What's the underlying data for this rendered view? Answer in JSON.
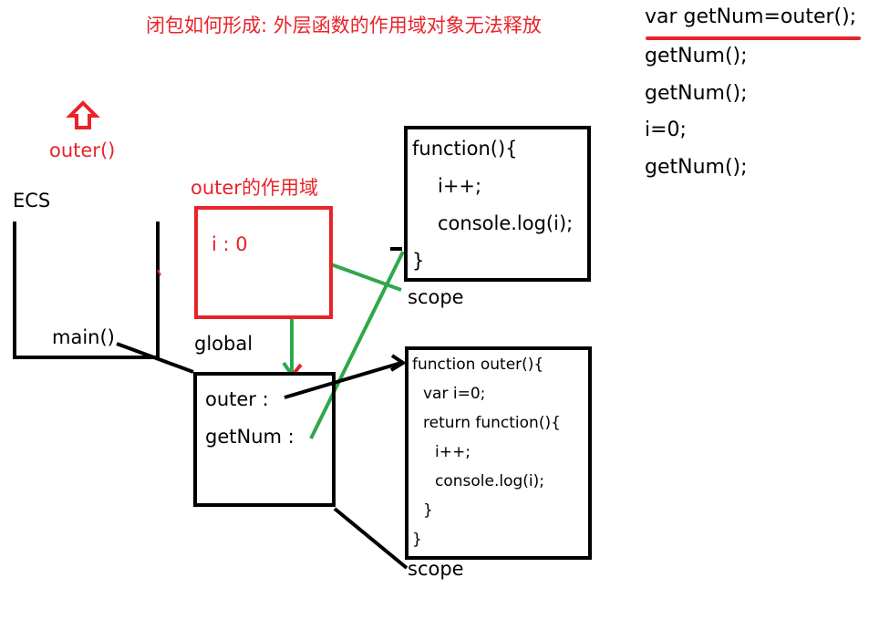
{
  "title": "闭包如何形成: 外层函数的作用域对象无法释放",
  "code_lines": [
    "var getNum=outer();",
    "getNum();",
    "getNum();",
    "i=0;",
    "getNum();"
  ],
  "stack": {
    "call_label": "outer()",
    "ecs_label": "ECS",
    "main_label": "main()"
  },
  "outer_scope": {
    "label": "outer的作用域",
    "var_i": "i : 0"
  },
  "global": {
    "label": "global",
    "outer_field": "outer :",
    "getnum_field": "getNum :"
  },
  "inner_function": {
    "lines": [
      "function(){",
      "i++;",
      "console.log(i);",
      "}"
    ],
    "scope_label": "scope"
  },
  "outer_function": {
    "lines": [
      "function outer(){",
      "var i=0;",
      "return function(){",
      "i++;",
      "console.log(i);",
      "}",
      "}"
    ],
    "scope_label": "scope"
  },
  "colors": {
    "red": "#e8232a",
    "green": "#2ea84a",
    "black": "#000000"
  }
}
